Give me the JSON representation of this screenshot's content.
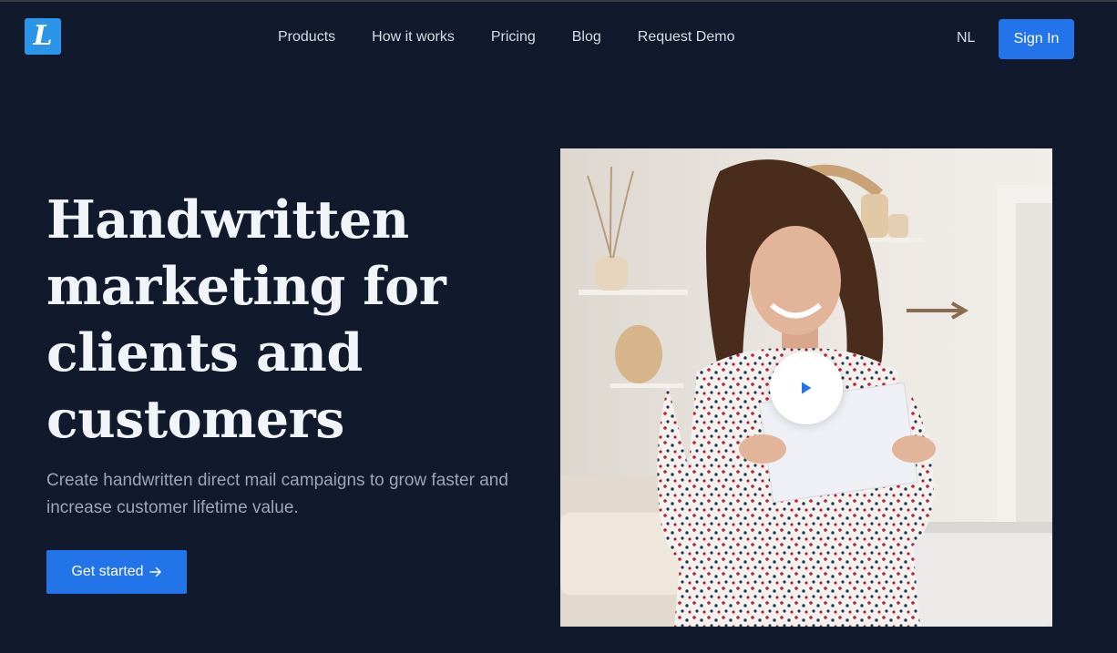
{
  "brand": {
    "logo_icon": "script-l-logo-icon",
    "accent": "#2374e8",
    "logo_bg": "#2b95ea"
  },
  "nav": {
    "items": [
      {
        "label": "Products"
      },
      {
        "label": "How it works"
      },
      {
        "label": "Pricing"
      },
      {
        "label": "Blog"
      },
      {
        "label": "Request Demo"
      }
    ]
  },
  "header": {
    "language": "NL",
    "signin_label": "Sign In"
  },
  "hero": {
    "title": "Handwritten marketing for clients and customers",
    "subtitle": "Create handwritten direct mail campaigns to grow faster and increase customer lifetime value.",
    "cta_label": "Get started",
    "cta_icon": "arrow-right-icon",
    "play_icon": "play-icon"
  }
}
